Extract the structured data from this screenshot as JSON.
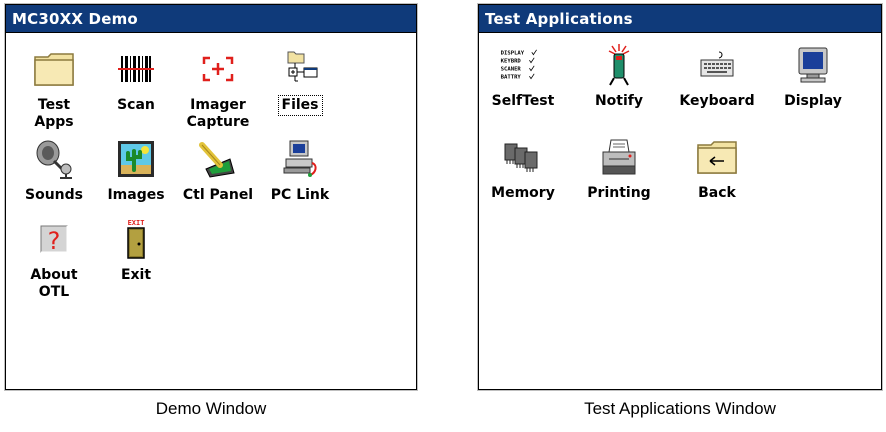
{
  "demo_window": {
    "title": "MC30XX Demo",
    "icons": [
      {
        "label": "Test\nApps",
        "icon": "folder-icon"
      },
      {
        "label": "Scan",
        "icon": "barcode-scan-icon"
      },
      {
        "label": "Imager\nCapture",
        "icon": "imager-capture-icon"
      },
      {
        "label": "Files",
        "icon": "files-tree-icon"
      },
      {
        "label": "Sounds",
        "icon": "speaker-microphone-icon"
      },
      {
        "label": "Images",
        "icon": "cactus-image-icon"
      },
      {
        "label": "Ctl Panel",
        "icon": "control-panel-icon"
      },
      {
        "label": "PC Link",
        "icon": "pc-link-icon"
      },
      {
        "label": "About\nOTL",
        "icon": "question-mark-icon"
      },
      {
        "label": "Exit",
        "icon": "exit-door-icon"
      }
    ]
  },
  "test_window": {
    "title": "Test Applications",
    "selftest_checklist": [
      "DISPLAY",
      "KEYBRD",
      "SCANER",
      "BATTRY"
    ],
    "exit_sign": "EXIT",
    "icons": [
      {
        "label": "SelfTest",
        "icon": "selftest-checklist-icon"
      },
      {
        "label": "Notify",
        "icon": "notify-beacon-icon"
      },
      {
        "label": "Keyboard",
        "icon": "keyboard-icon"
      },
      {
        "label": "Display",
        "icon": "monitor-icon"
      },
      {
        "label": "Memory",
        "icon": "memory-chips-icon"
      },
      {
        "label": "Printing",
        "icon": "printer-icon"
      },
      {
        "label": "Back",
        "icon": "back-folder-icon"
      }
    ]
  },
  "captions": {
    "demo": "Demo Window",
    "test": "Test Applications Window"
  }
}
